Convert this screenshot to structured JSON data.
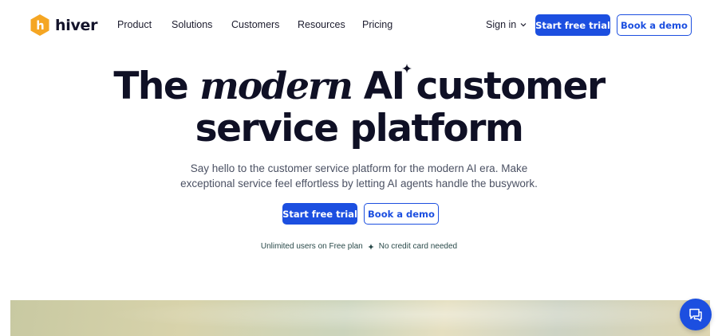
{
  "brand": {
    "name": "hiver",
    "logo_icon": "hiver-hexagon-logo",
    "accent_color": "#1c4fe0",
    "logo_color": "#f5a623"
  },
  "nav": {
    "links": [
      "Product",
      "Solutions",
      "Customers",
      "Resources",
      "Pricing"
    ],
    "sign_in": "Sign in",
    "start_trial": "Start free trial",
    "book_demo": "Book a demo"
  },
  "hero": {
    "title_the": "The",
    "title_modern": "modern",
    "title_ai": "AI",
    "title_customer": "customer",
    "title_line2": "service platform",
    "subtitle": "Say hello to the customer service platform for the modern AI era. Make exceptional service feel effortless by letting AI agents handle the busywork.",
    "cta_primary": "Start free trial",
    "cta_secondary": "Book a demo",
    "note_left": "Unlimited users on Free plan",
    "note_right": "No credit card needed"
  },
  "chat_widget": {
    "icon": "chat-bubble-icon"
  }
}
